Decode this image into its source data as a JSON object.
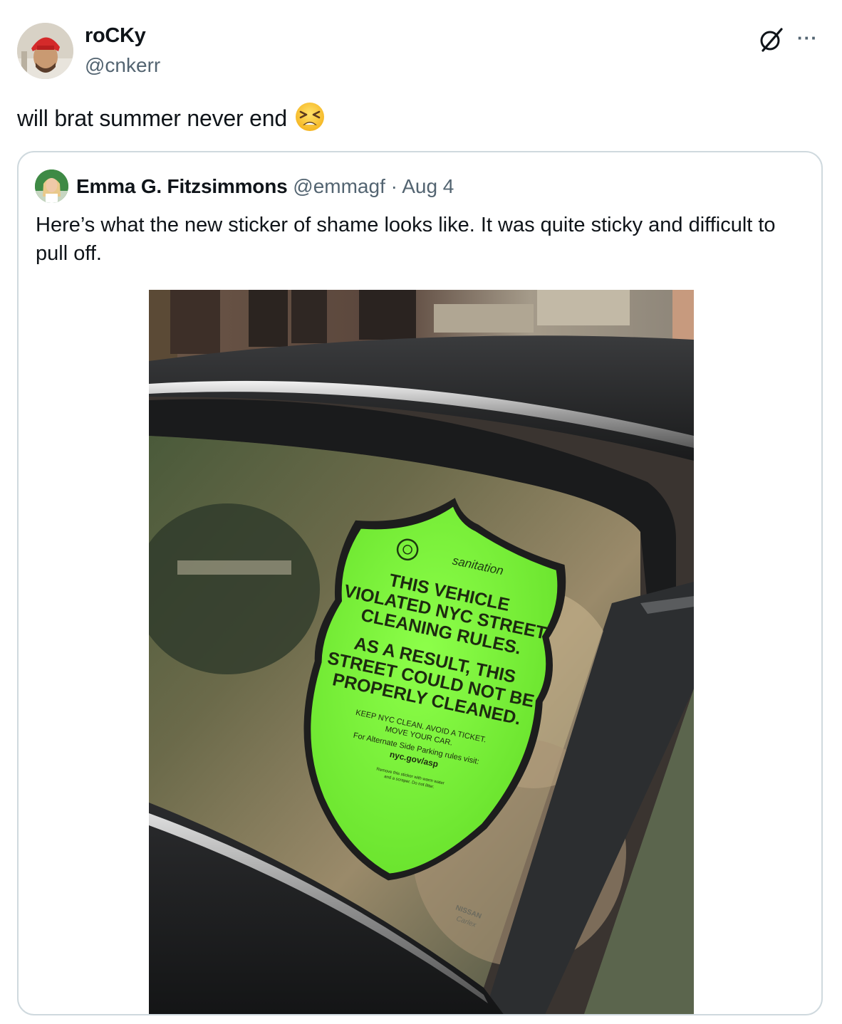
{
  "tweet": {
    "author_name": "roCKy",
    "author_handle": "@cnkerr",
    "text": "will brat summer never end",
    "emoji_icon": "tired-face-emoji",
    "more_label": "···"
  },
  "quoted_tweet": {
    "author_name": "Emma G. Fitzsimmons",
    "author_handle": "@emmagf",
    "separator": " · ",
    "date": "Aug 4",
    "text": "Here’s what the new sticker of shame looks like. It was quite sticky and difficult to pull off.",
    "photo": {
      "sticker": {
        "brand": "sanitation",
        "headline_lines": [
          "THIS VEHICLE",
          "VIOLATED NYC STREET",
          "CLEANING RULES."
        ],
        "result_lines": [
          "AS A RESULT, THIS",
          "STREET COULD NOT BE",
          "PROPERLY CLEANED."
        ],
        "small_lines": [
          "KEEP NYC CLEAN. AVOID A TICKET.",
          "MOVE YOUR CAR.",
          "For Alternate Side Parking rules visit:"
        ],
        "url": "nyc.gov/asp",
        "fine_print_lines": [
          "Remove this sticker with warm water",
          "and a scraper. Do not litter."
        ],
        "color": "#7cf53a"
      },
      "glass_label_lines": [
        "NISSAN",
        "Carlex"
      ]
    }
  },
  "colors": {
    "text_primary": "#0f1419",
    "text_secondary": "#536471",
    "border": "#cfd9de",
    "sticker_green": "#7cf53a"
  }
}
